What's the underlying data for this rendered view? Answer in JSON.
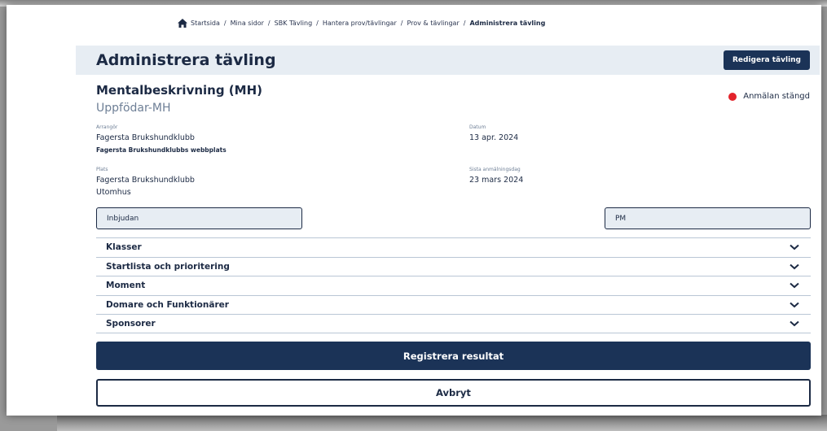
{
  "breadcrumb": {
    "items": [
      "Startsida",
      "Mina sidor",
      "SBK Tävling",
      "Hantera prov/tävlingar",
      "Prov & tävlingar"
    ],
    "current": "Administrera tävling",
    "separator": "/"
  },
  "header": {
    "title": "Administrera tävling",
    "edit_button": "Redigera tävling"
  },
  "event": {
    "title": "Mentalbeskrivning (MH)",
    "subtitle": "Uppfödar-MH",
    "status": "Anmälan stängd",
    "status_color": "#e3232b"
  },
  "info": {
    "organizer_label": "Arrangör",
    "organizer_value": "Fagersta Brukshundklubb",
    "organizer_link": "Fagersta Brukshundklubbs webbplats",
    "date_label": "Datum",
    "date_value": "13 apr. 2024",
    "place_label": "Plats",
    "place_value": "Fagersta Brukshundklubb",
    "place_detail": "Utomhus",
    "deadline_label": "Sista anmälningsdag",
    "deadline_value": "23 mars 2024"
  },
  "documents": {
    "invitation": "Inbjudan",
    "pm": "PM"
  },
  "accordion": [
    {
      "label": "Klasser"
    },
    {
      "label": "Startlista och prioritering"
    },
    {
      "label": "Moment"
    },
    {
      "label": "Domare och Funktionärer"
    },
    {
      "label": "Sponsorer"
    }
  ],
  "actions": {
    "register": "Registrera resultat",
    "cancel": "Avbryt"
  },
  "colors": {
    "primary": "#1b3357",
    "header_bg": "#e7edf3",
    "status_red": "#e3232b"
  },
  "icons": {
    "home": "home-icon",
    "chevron": "chevron-down-icon"
  }
}
